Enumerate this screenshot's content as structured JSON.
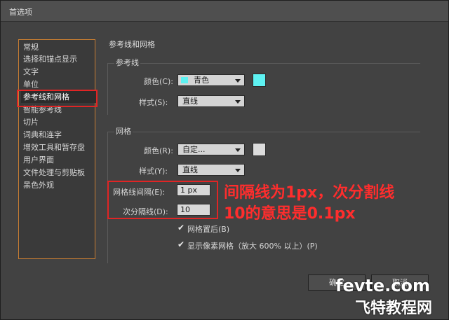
{
  "window": {
    "title": "首选项"
  },
  "sidebar": {
    "items": [
      {
        "label": "常规"
      },
      {
        "label": "选择和锚点显示"
      },
      {
        "label": "文字"
      },
      {
        "label": "单位"
      },
      {
        "label": "参考线和网格"
      },
      {
        "label": "智能参考线"
      },
      {
        "label": "切片"
      },
      {
        "label": "词典和连字"
      },
      {
        "label": "增效工具和暂存盘"
      },
      {
        "label": "用户界面"
      },
      {
        "label": "文件处理与剪贴板"
      },
      {
        "label": "黑色外观"
      }
    ],
    "selected": "参考线和网格"
  },
  "main": {
    "section_title": "参考线和网格",
    "guides": {
      "label": "参考线",
      "color_label": "颜色(C):",
      "color_value": "青色",
      "color_hex": "#5ef2f2",
      "style_label": "样式(S):",
      "style_value": "直线"
    },
    "grid": {
      "label": "网格",
      "color_label": "颜色(R):",
      "color_value": "自定...",
      "color_hex": "#dcdcdc",
      "style_label": "样式(Y):",
      "style_value": "直线",
      "gridline_label": "网格线间隔(E):",
      "gridline_value": "1 px",
      "subdiv_label": "次分隔线(D):",
      "subdiv_value": "10",
      "grids_in_back_label": "网格置后(B)",
      "grids_in_back_checked": true,
      "pixel_grid_label": "显示像素网格（放大 600% 以上）(P)",
      "pixel_grid_checked": true
    }
  },
  "annotation": {
    "line1": "间隔线为1px，次分割线",
    "line2": "10的意思是0.1px",
    "color": "#ff2d2d"
  },
  "buttons": {
    "ok": "确定",
    "cancel": "取消"
  },
  "watermark": {
    "line1": "fevte.com",
    "line2": "飞特教程网"
  },
  "icons": {
    "checkbox": "check-icon",
    "dropdown": "chevron-down-icon"
  }
}
